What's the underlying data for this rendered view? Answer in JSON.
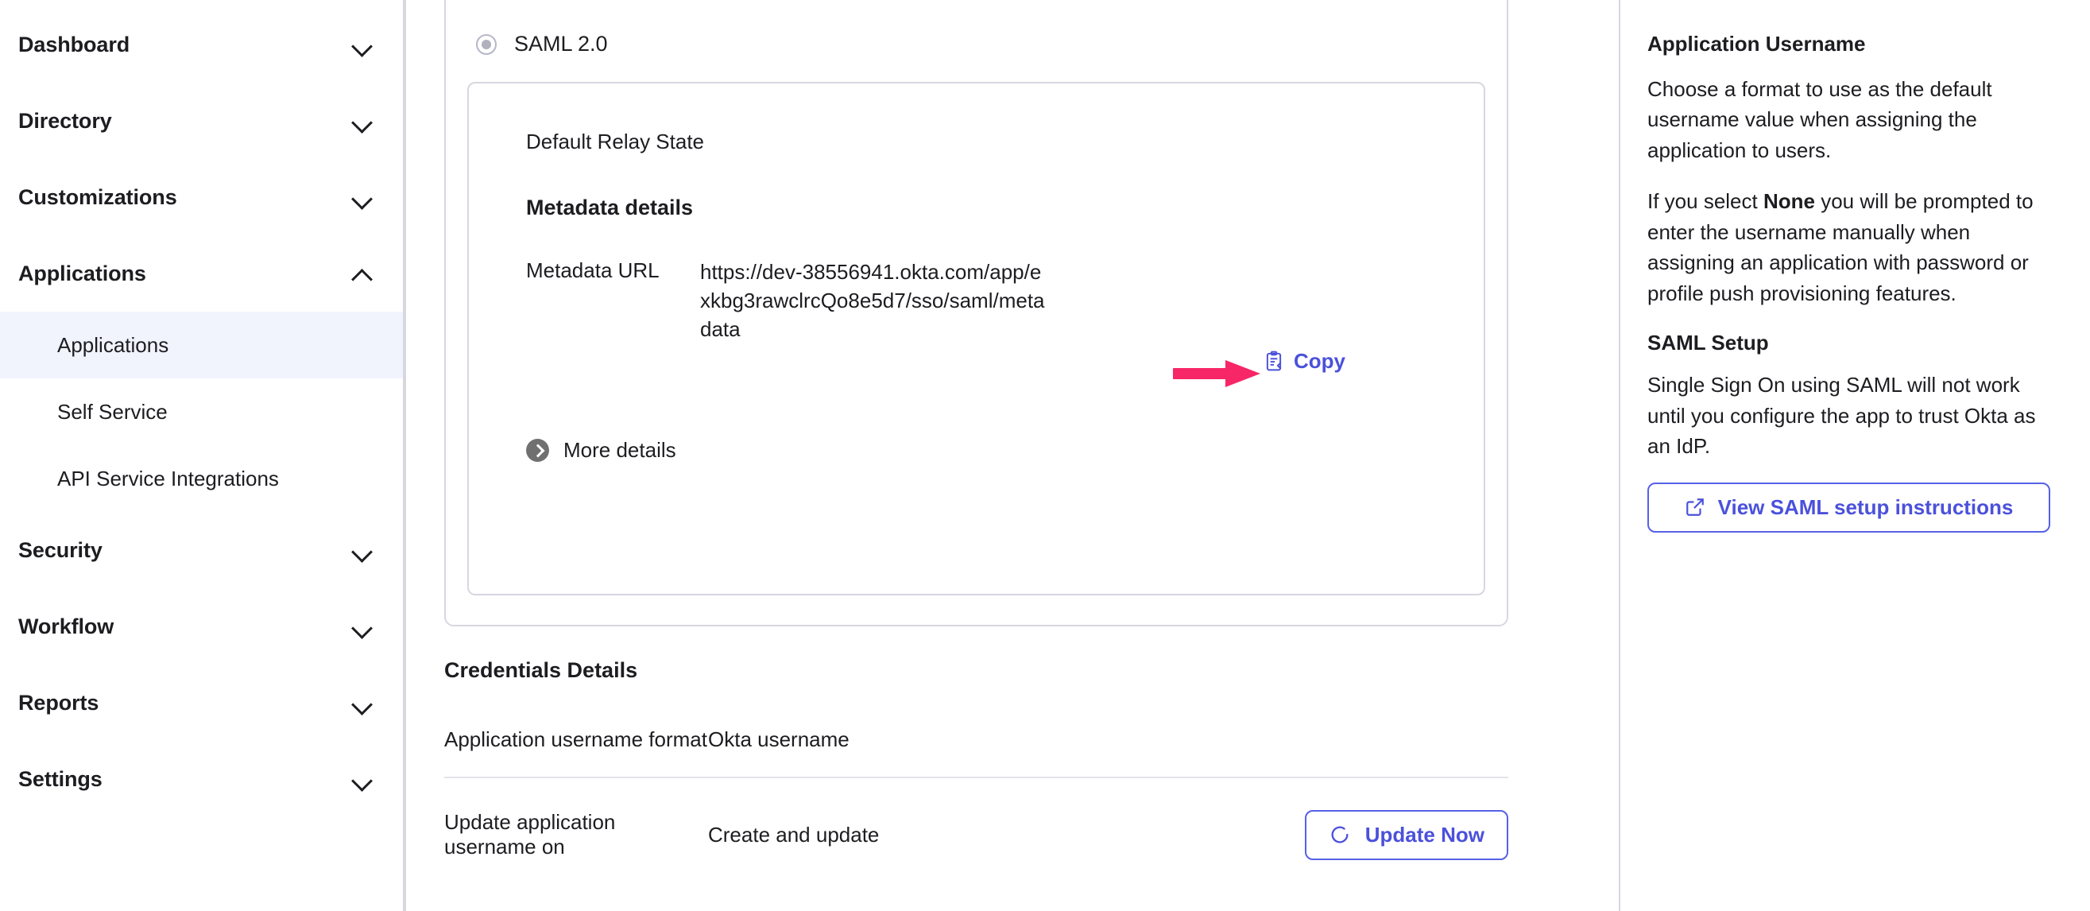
{
  "sidebar": {
    "groups": [
      {
        "label": "Dashboard",
        "icon": "chevron-down-icon",
        "expanded": false,
        "children": []
      },
      {
        "label": "Directory",
        "icon": "chevron-down-icon",
        "expanded": false,
        "children": []
      },
      {
        "label": "Customizations",
        "icon": "chevron-down-icon",
        "expanded": false,
        "children": []
      },
      {
        "label": "Applications",
        "icon": "chevron-up-icon",
        "expanded": true,
        "children": [
          {
            "label": "Applications",
            "active": true
          },
          {
            "label": "Self Service",
            "active": false
          },
          {
            "label": "API Service Integrations",
            "active": false
          }
        ]
      },
      {
        "label": "Security",
        "icon": "chevron-down-icon",
        "expanded": false,
        "children": []
      },
      {
        "label": "Workflow",
        "icon": "chevron-down-icon",
        "expanded": false,
        "children": []
      },
      {
        "label": "Reports",
        "icon": "chevron-down-icon",
        "expanded": false,
        "children": []
      },
      {
        "label": "Settings",
        "icon": "chevron-down-icon",
        "expanded": false,
        "children": []
      }
    ]
  },
  "main": {
    "protocol_option": {
      "label": "SAML 2.0",
      "selected": true,
      "control": "radio"
    },
    "default_relay_state_label": "Default Relay State",
    "metadata": {
      "heading": "Metadata details",
      "url_label": "Metadata URL",
      "url_value": "https://dev-38556941.okta.com/app/exkbg3rawclrcQo8e5d7/sso/saml/metadata",
      "copy_label": "Copy",
      "copy_icon": "clipboard-copy-icon"
    },
    "more_details_label": "More details",
    "more_details_icon": "chevron-right-circle-icon",
    "credentials": {
      "heading": "Credentials Details",
      "rows": [
        {
          "label": "Application username format",
          "value": "Okta username",
          "action": null
        },
        {
          "label": "Update application username on",
          "value": "Create and update",
          "action": "Update Now"
        }
      ],
      "update_now_label": "Update Now",
      "update_now_icon": "refresh-icon"
    }
  },
  "right_panel": {
    "app_username": {
      "title": "Application Username",
      "paragraph_1": "Choose a format to use as the default username value when assigning the application to users.",
      "paragraph_2_pre": "If you select ",
      "paragraph_2_bold": "None",
      "paragraph_2_post": " you will be prompted to enter the username manually when assigning an application with password or profile push provisioning features."
    },
    "saml_setup": {
      "title": "SAML Setup",
      "paragraph": "Single Sign On using SAML will not work until you configure the app to trust Okta as an IdP.",
      "button_label": "View SAML setup instructions",
      "button_icon": "external-link-icon"
    }
  },
  "annotation": {
    "arrow": "right-arrow-annotation",
    "arrow_color": "#f72667",
    "points_to": "Copy"
  },
  "colors": {
    "accent_blue": "#4b51db",
    "border_blue": "#5661e6",
    "annotation_pink": "#f72667",
    "active_nav_bg": "#f1f3fd",
    "border_gray": "#d7d7e0",
    "text": "#1d1d21"
  }
}
